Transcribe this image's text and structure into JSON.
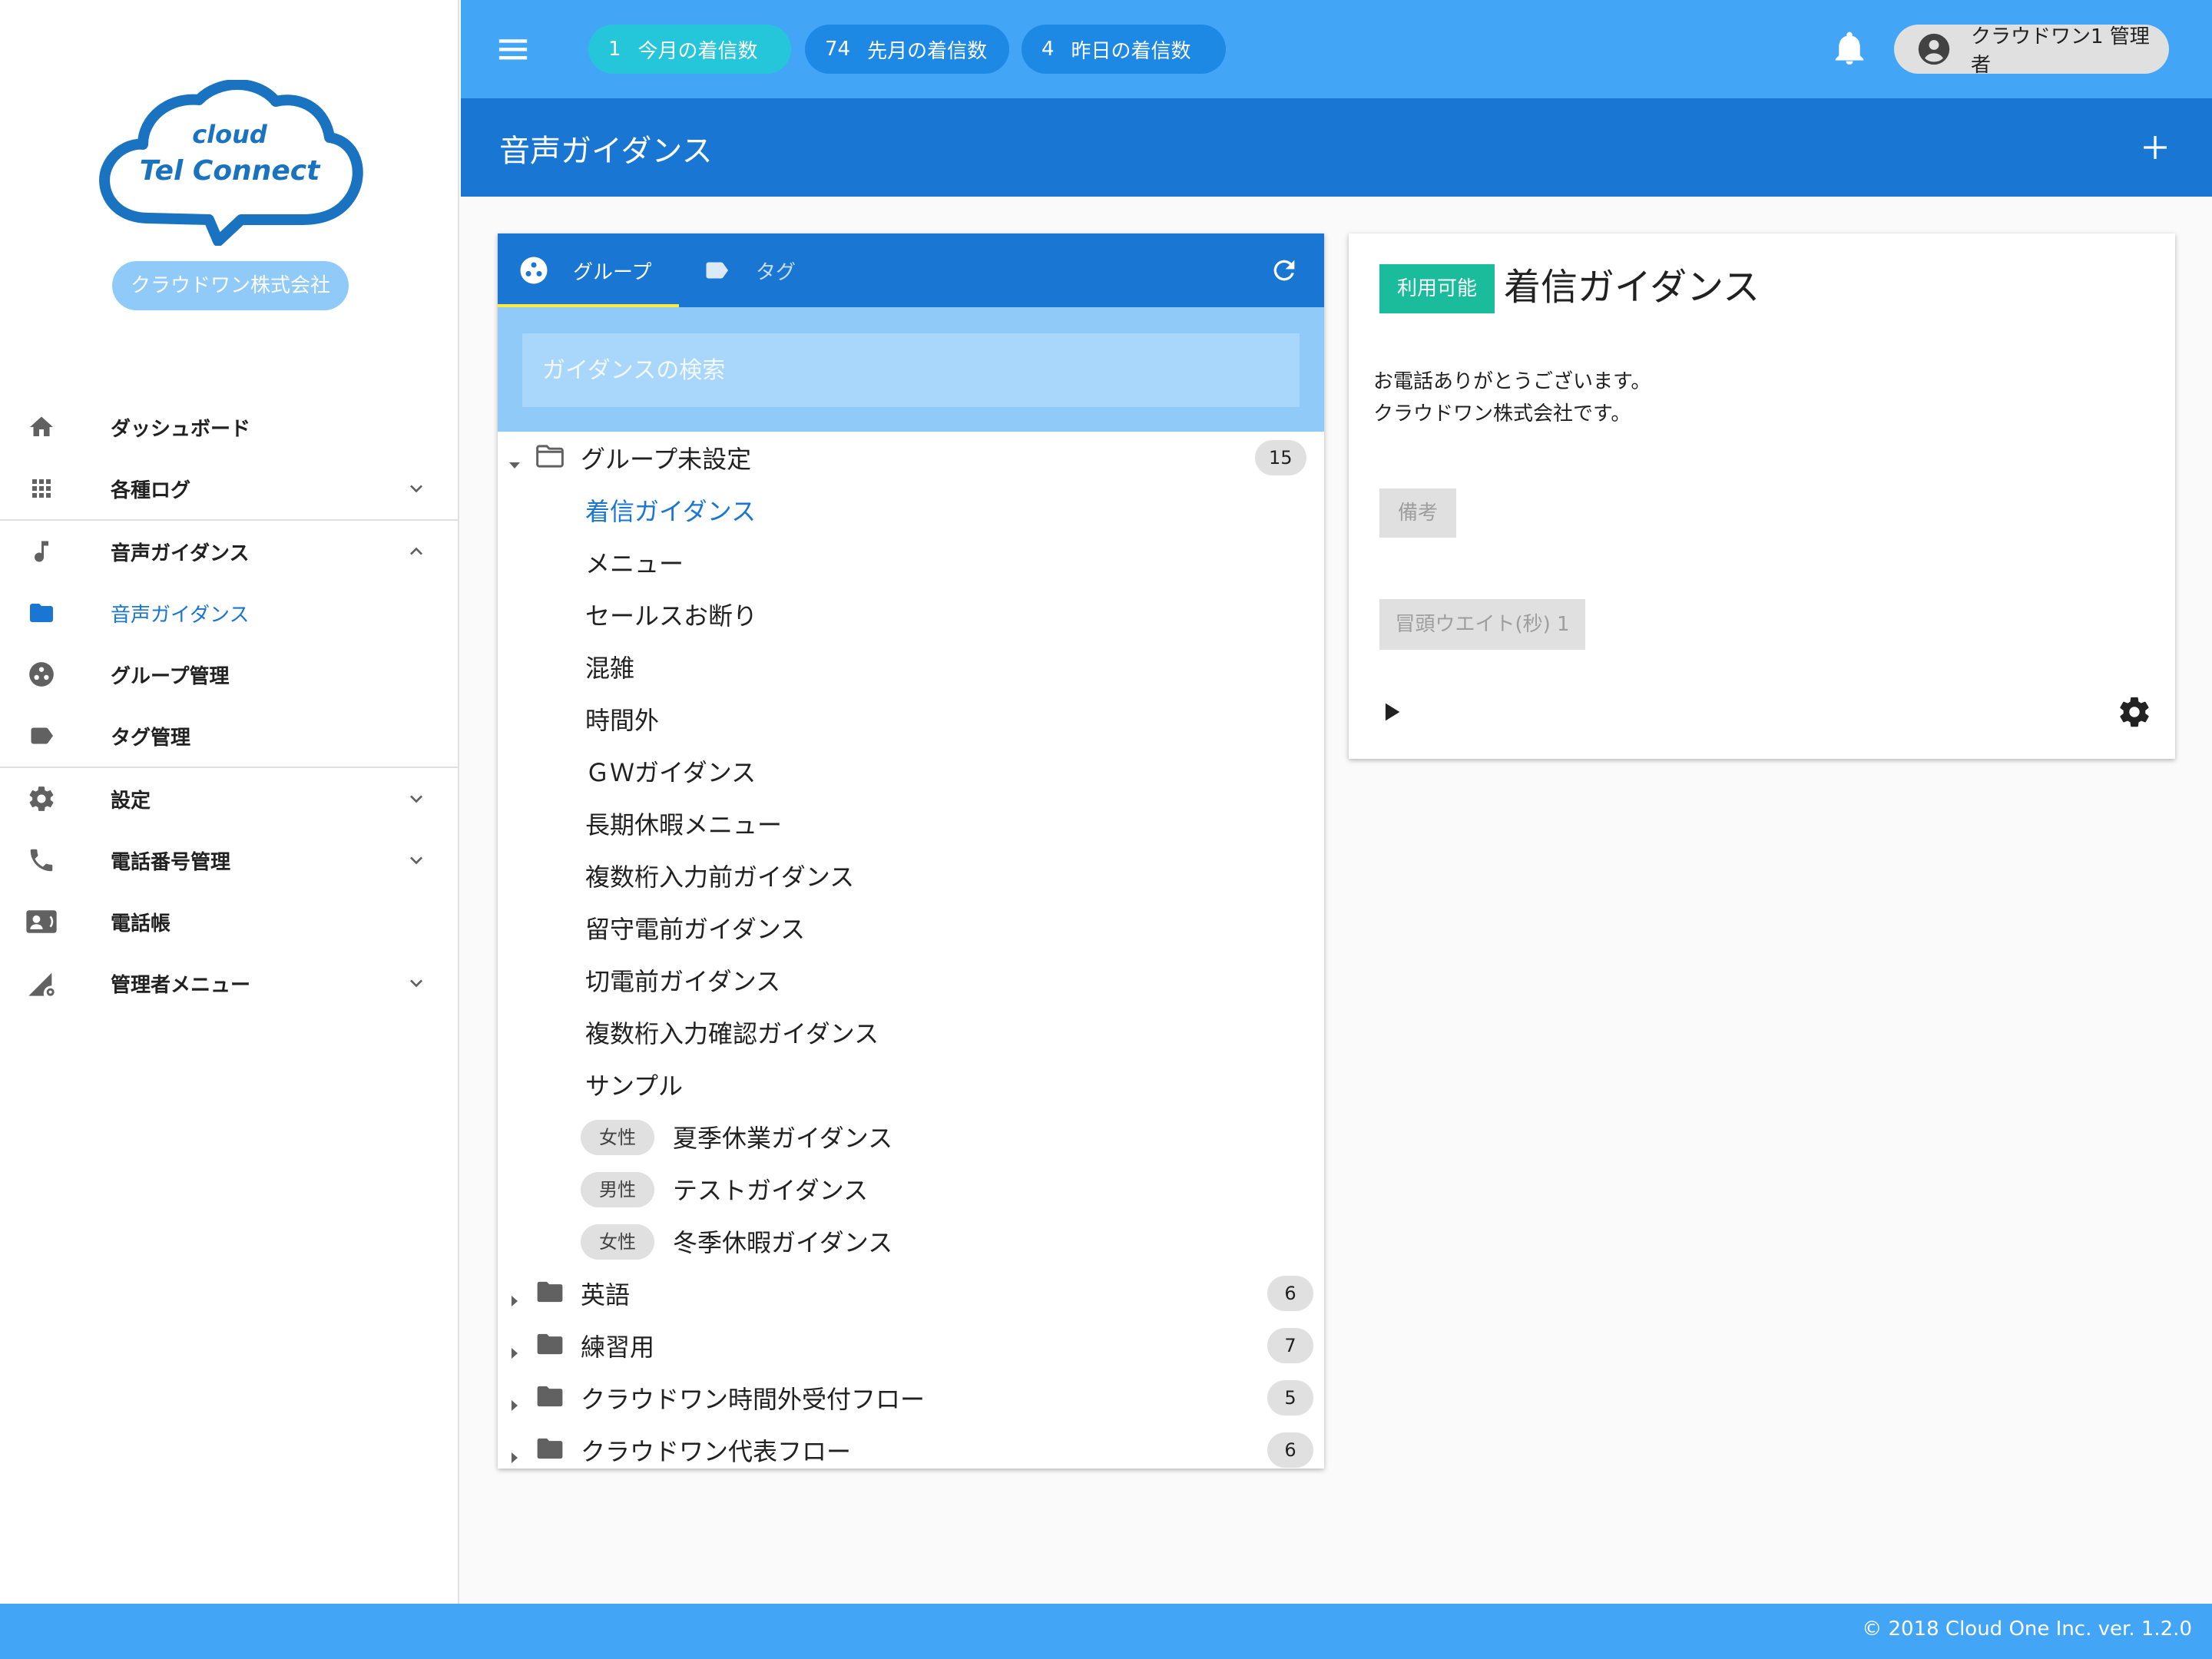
{
  "sidebar": {
    "logo_top": "cloud",
    "logo_bottom": "Tel Connect",
    "company": "クラウドワン株式会社",
    "items": [
      {
        "label": "ダッシュボード",
        "icon": "home-icon"
      },
      {
        "label": "各種ログ",
        "icon": "apps-icon"
      },
      {
        "label": "音声ガイダンス",
        "icon": "music-note-icon"
      },
      {
        "label": "音声ガイダンス",
        "icon": "folder-icon"
      },
      {
        "label": "グループ管理",
        "icon": "group-icon"
      },
      {
        "label": "タグ管理",
        "icon": "tag-icon"
      },
      {
        "label": "設定",
        "icon": "gear-icon"
      },
      {
        "label": "電話番号管理",
        "icon": "phone-icon"
      },
      {
        "label": "電話帳",
        "icon": "contact-card-icon"
      },
      {
        "label": "管理者メニュー",
        "icon": "admin-signal-icon"
      }
    ]
  },
  "topbar": {
    "stats": [
      {
        "value": "1",
        "label": "今月の着信数"
      },
      {
        "value": "74",
        "label": "先月の着信数"
      },
      {
        "value": "4",
        "label": "昨日の着信数"
      }
    ],
    "user": "クラウドワン1 管理者"
  },
  "page": {
    "title": "音声ガイダンス"
  },
  "list": {
    "tabs": [
      {
        "label": "グループ"
      },
      {
        "label": "タグ"
      }
    ],
    "search_placeholder": "ガイダンスの検索",
    "groups": [
      {
        "label": "グループ未設定",
        "count": "15"
      },
      {
        "label": "英語",
        "count": "6"
      },
      {
        "label": "練習用",
        "count": "7"
      },
      {
        "label": "クラウドワン時間外受付フロー",
        "count": "5"
      },
      {
        "label": "クラウドワン代表フロー",
        "count": "6"
      }
    ],
    "guidances": [
      {
        "label": "着信ガイダンス"
      },
      {
        "label": "メニュー"
      },
      {
        "label": "セールスお断り"
      },
      {
        "label": "混雑"
      },
      {
        "label": "時間外"
      },
      {
        "label": "ＧＷガイダンス"
      },
      {
        "label": "長期休暇メニュー"
      },
      {
        "label": "複数桁入力前ガイダンス"
      },
      {
        "label": "留守電前ガイダンス"
      },
      {
        "label": "切電前ガイダンス"
      },
      {
        "label": "複数桁入力確認ガイダンス"
      },
      {
        "label": "サンプル"
      },
      {
        "label": "夏季休業ガイダンス",
        "tag": "女性"
      },
      {
        "label": "テストガイダンス",
        "tag": "男性"
      },
      {
        "label": "冬季休暇ガイダンス",
        "tag": "女性"
      }
    ]
  },
  "detail": {
    "status": "利用可能",
    "title": "着信ガイダンス",
    "body_line1": "お電話ありがとうございます。",
    "body_line2": "クラウドワン株式会社です。",
    "memo": "備考",
    "wait": "冒頭ウエイト(秒) 1"
  },
  "footer": {
    "text": "© 2018 Cloud One Inc. ver. 1.2.0"
  },
  "colors": {
    "primary": "#1976d2",
    "topbar": "#42a5f5",
    "accent_chip": "#26c6da",
    "status_green": "#1abc9c",
    "search_bg": "#90caf9"
  }
}
